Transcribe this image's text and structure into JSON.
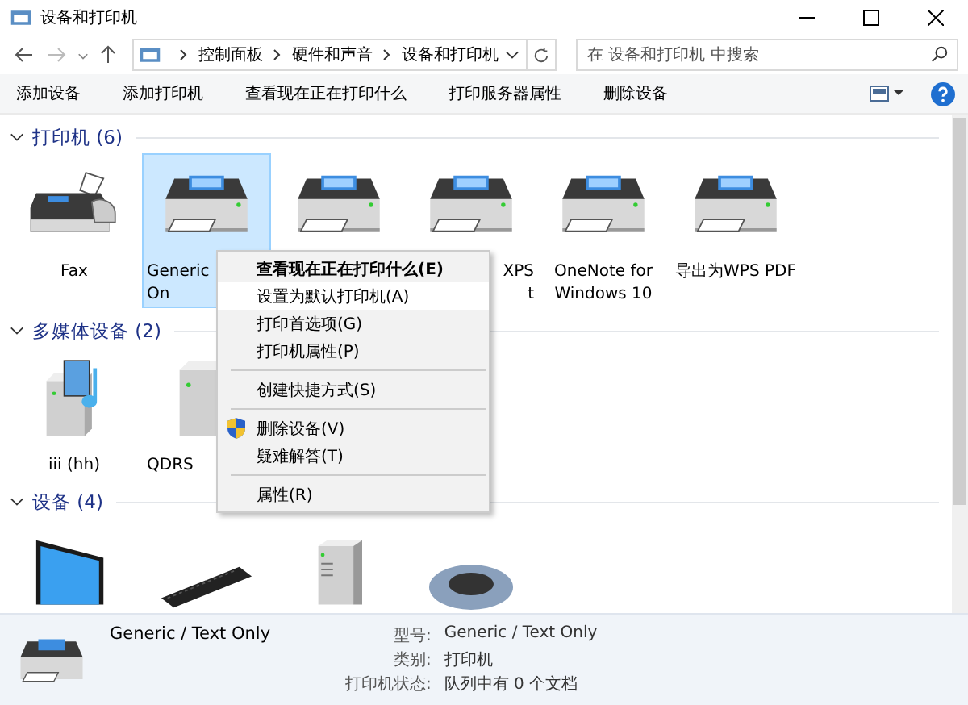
{
  "window": {
    "title": "设备和打印机"
  },
  "address": {
    "crumbs": [
      "控制面板",
      "硬件和声音",
      "设备和打印机"
    ]
  },
  "search": {
    "placeholder": "在 设备和打印机 中搜索"
  },
  "toolbar": [
    "添加设备",
    "添加打印机",
    "查看现在正在打印什么",
    "打印服务器属性",
    "删除设备"
  ],
  "groups": [
    {
      "title": "打印机 (6)",
      "items": [
        {
          "kind": "fax",
          "label": [
            "Fax"
          ],
          "cut_left": false,
          "cut_right": false,
          "selected": false
        },
        {
          "kind": "printer",
          "label": [
            "Generic",
            "On"
          ],
          "cut_left": false,
          "cut_right": true,
          "selected": true
        },
        {
          "kind": "printer",
          "selected": false
        },
        {
          "kind": "printer",
          "label": [
            "XPS",
            "t"
          ],
          "cut_left": true,
          "cut_right": false,
          "selected": false
        },
        {
          "kind": "printer",
          "label": [
            "OneNote for",
            "Windows 10"
          ],
          "cut_left": false,
          "cut_right": false,
          "selected": false
        },
        {
          "kind": "printer",
          "label": [
            "导出为WPS PDF"
          ],
          "cut_left": false,
          "cut_right": false,
          "selected": false
        }
      ]
    },
    {
      "title": "多媒体设备 (2)",
      "items": [
        {
          "kind": "media",
          "label": [
            "iii (hh)"
          ],
          "cut_left": false,
          "cut_right": false,
          "selected": false
        },
        {
          "kind": "server",
          "label": [
            "QDRS"
          ],
          "cut_left": false,
          "cut_right": true,
          "selected": false
        }
      ]
    },
    {
      "title": "设备 (4)",
      "items": [
        {
          "kind": "monitor",
          "selected": false
        },
        {
          "kind": "keyboard",
          "selected": false
        },
        {
          "kind": "tower",
          "selected": false
        },
        {
          "kind": "mouse",
          "selected": false
        }
      ]
    }
  ],
  "context_menu": [
    {
      "kind": "default",
      "label": "查看现在正在打印什么(E)",
      "selected": false
    },
    {
      "kind": "item",
      "label": "设置为默认打印机(A)",
      "selected": true
    },
    {
      "kind": "item",
      "label": "打印首选项(G)",
      "selected": false
    },
    {
      "kind": "item",
      "label": "打印机属性(P)",
      "selected": false
    },
    {
      "kind": "separator"
    },
    {
      "kind": "item",
      "label": "创建快捷方式(S)",
      "selected": false
    },
    {
      "kind": "separator"
    },
    {
      "kind": "admin",
      "label": "删除设备(V)",
      "selected": false
    },
    {
      "kind": "item",
      "label": "疑难解答(T)",
      "selected": false
    },
    {
      "kind": "separator"
    },
    {
      "kind": "item",
      "label": "属性(R)",
      "selected": false
    }
  ],
  "details": {
    "name": "Generic / Text Only",
    "fields": [
      {
        "label": "型号:",
        "value": "Generic / Text Only"
      },
      {
        "label": "类别:",
        "value": "打印机"
      },
      {
        "label": "打印机状态:",
        "value": "队列中有 0 个文档"
      }
    ]
  }
}
